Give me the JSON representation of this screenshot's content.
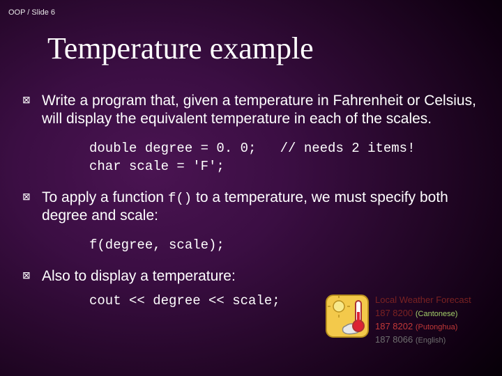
{
  "slide_label": "OOP / Slide 6",
  "title": "Temperature example",
  "items": [
    {
      "text": "Write a program that, given a temperature in Fahrenheit or Celsius, will display the equivalent temperature in each of the scales.",
      "code": "double degree = 0. 0;   // needs 2 items!\nchar scale = 'F';"
    },
    {
      "text_before": "To apply a function ",
      "inline_code": "f()",
      "text_after": " to a temperature, we must specify both degree and scale:",
      "code": "f(degree, scale);"
    },
    {
      "text": "Also to display a temperature:",
      "code": "cout << degree << scale;"
    }
  ],
  "weather": {
    "header": "Local Weather Forecast",
    "lines": [
      {
        "num": "187 8200",
        "note": "(Cantonese)",
        "num_cls": "wt-dimred",
        "note_cls": "wt-green wt-small"
      },
      {
        "num": "187 8202",
        "note": "(Putonghua)",
        "num_cls": "wt-red",
        "note_cls": "wt-red wt-small"
      },
      {
        "num": "187 8066",
        "note": "(English)",
        "num_cls": "wt-gray",
        "note_cls": "wt-gray wt-small"
      }
    ]
  }
}
